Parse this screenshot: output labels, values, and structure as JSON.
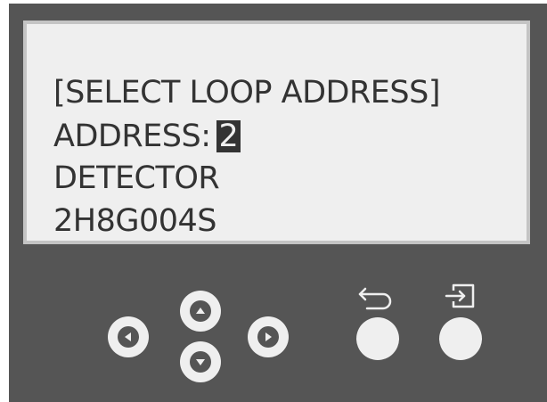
{
  "display": {
    "line1": "[SELECT LOOP ADDRESS]",
    "address_label": "ADDRESS:",
    "address_value": "2",
    "line3": "DETECTOR",
    "line4": "2H8G004S"
  },
  "buttons": {
    "left": "arrow-left-icon",
    "up": "arrow-up-icon",
    "down": "arrow-down-icon",
    "right": "arrow-right-icon",
    "back": "back-icon",
    "enter": "enter-icon"
  },
  "colors": {
    "panel": "#555555",
    "screen": "#efefef",
    "screen_border": "#c4c4c4",
    "text": "#333333",
    "button": "#efefef"
  }
}
